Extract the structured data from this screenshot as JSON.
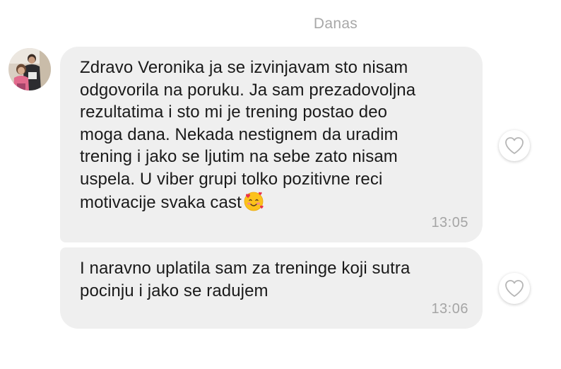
{
  "date_separator": "Danas",
  "messages": [
    {
      "text": "Zdravo  Veronika ja se izvinjavam sto nisam\nodgovorila na poruku. Ja sam prezadovoljna\nrezultatima i sto mi je trening postao deo\nmoga dana. Nekada nestignem da uradim\ntrening i jako se ljutim na sebe zato nisam\nuspela. U viber grupi tolko pozitivne reci\nmotivacije svaka cast",
      "emoji": "smiling-face-with-hearts",
      "time": "13:05",
      "liked": false
    },
    {
      "text": "I naravno uplatila sam za treninge koji sutra\npocinju i jako se radujem",
      "time": "13:06",
      "liked": false
    }
  ],
  "icons": {
    "like": "heart-outline-icon",
    "avatar": "user-avatar-photo"
  },
  "colors": {
    "bubble_background": "#efefef",
    "message_text": "#1a1a1a",
    "timestamp": "#a5a5a5",
    "date_separator": "#a8a8a8",
    "heart_outline": "#b5b5b5"
  }
}
